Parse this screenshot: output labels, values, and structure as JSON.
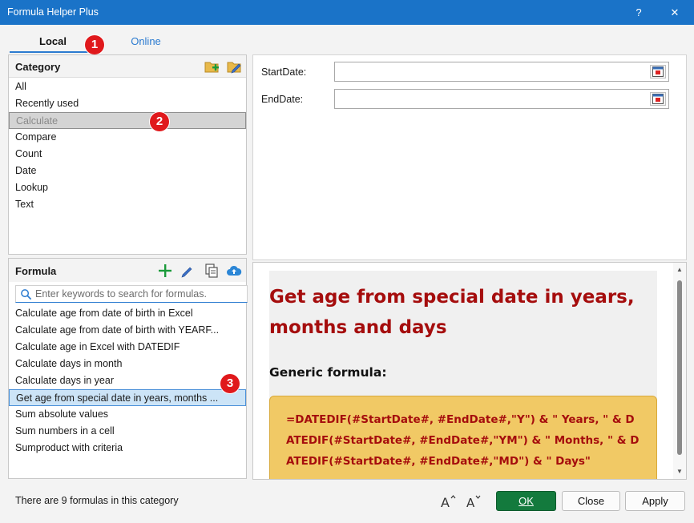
{
  "window": {
    "title": "Formula Helper Plus",
    "help_label": "?",
    "close_label": "✕"
  },
  "tabs": [
    {
      "label": "Local",
      "active": true
    },
    {
      "label": "Online",
      "active": false
    }
  ],
  "callouts": [
    "1",
    "2",
    "3"
  ],
  "category_panel": {
    "title": "Category",
    "items": [
      "All",
      "Recently used",
      "Calculate",
      "Compare",
      "Count",
      "Date",
      "Lookup",
      "Text"
    ],
    "selected": "Calculate"
  },
  "formula_panel": {
    "title": "Formula",
    "search_placeholder": "Enter keywords to search for formulas.",
    "items": [
      "Calculate age from date of birth in Excel",
      "Calculate age from date of birth with YEARF...",
      "Calculate age in Excel with DATEDIF",
      "Calculate days in month",
      "Calculate days in year",
      "Get age from special date in years, months ...",
      "Sum absolute values",
      "Sum numbers in a cell",
      "Sumproduct with criteria"
    ],
    "selected": "Get age from special date in years, months ..."
  },
  "parameters": [
    {
      "label": "StartDate:",
      "value": ""
    },
    {
      "label": "EndDate:",
      "value": ""
    }
  ],
  "preview": {
    "heading": "Get age from special date in years, months and days",
    "generic_label": "Generic formula:",
    "formula": "=DATEDIF(#StartDate#, #EndDate#,\"Y\") & \" Years, \" & DATEDIF(#StartDate#, #EndDate#,\"YM\") & \" Months, \" & DATEDIF(#StartDate#, #EndDate#,\"MD\") & \" Days\""
  },
  "status_text": "There are 9 formulas in this category",
  "buttons": {
    "ok": "OK",
    "close": "Close",
    "apply": "Apply"
  },
  "colors": {
    "titlebar": "#1a73c8",
    "accent": "#2b7bd0",
    "ok_button": "#137a3d",
    "heading_red": "#a50d0d",
    "formula_box": "#f1c965",
    "callout_red": "#e0191c"
  }
}
